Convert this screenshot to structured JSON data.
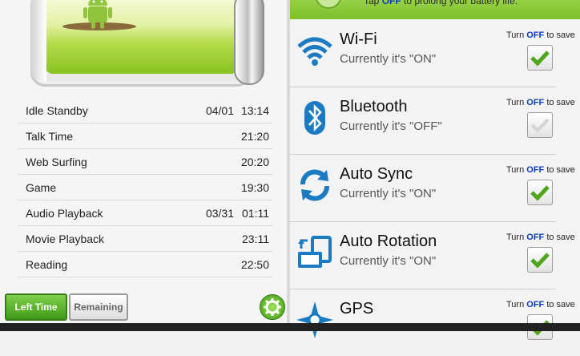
{
  "stats": [
    {
      "label": "Idle Standby",
      "date": "04/01",
      "time": "13:14"
    },
    {
      "label": "Talk Time",
      "date": "",
      "time": "21:20"
    },
    {
      "label": "Web Surfing",
      "date": "",
      "time": "20:20"
    },
    {
      "label": "Game",
      "date": "",
      "time": "19:30"
    },
    {
      "label": "Audio Playback",
      "date": "03/31",
      "time": "01:11"
    },
    {
      "label": "Movie Playback",
      "date": "",
      "time": "23:11"
    },
    {
      "label": "Reading",
      "date": "",
      "time": "22:50"
    }
  ],
  "buttons": {
    "left_time": "Left Time",
    "remaining": "Remaining"
  },
  "tip": {
    "prefix": "Tap ",
    "off": "OFF",
    "suffix": " to prolong your battery life."
  },
  "toggles": [
    {
      "name": "Wi-Fi",
      "state": "Currently it's \"ON\"",
      "checked": true,
      "icon": "wifi-icon"
    },
    {
      "name": "Bluetooth",
      "state": "Currently it's \"OFF\"",
      "checked": false,
      "icon": "bluetooth-icon"
    },
    {
      "name": "Auto Sync",
      "state": "Currently it's \"ON\"",
      "checked": true,
      "icon": "sync-icon"
    },
    {
      "name": "Auto Rotation",
      "state": "Currently it's \"ON\"",
      "checked": true,
      "icon": "rotation-icon"
    },
    {
      "name": "GPS",
      "state": "",
      "checked": true,
      "icon": "gps-icon"
    }
  ],
  "hint": {
    "prefix": "Turn ",
    "off": "OFF",
    "suffix": " to save"
  },
  "colors": {
    "accent_green": "#5fb323",
    "off_blue": "#0b3fb5"
  }
}
